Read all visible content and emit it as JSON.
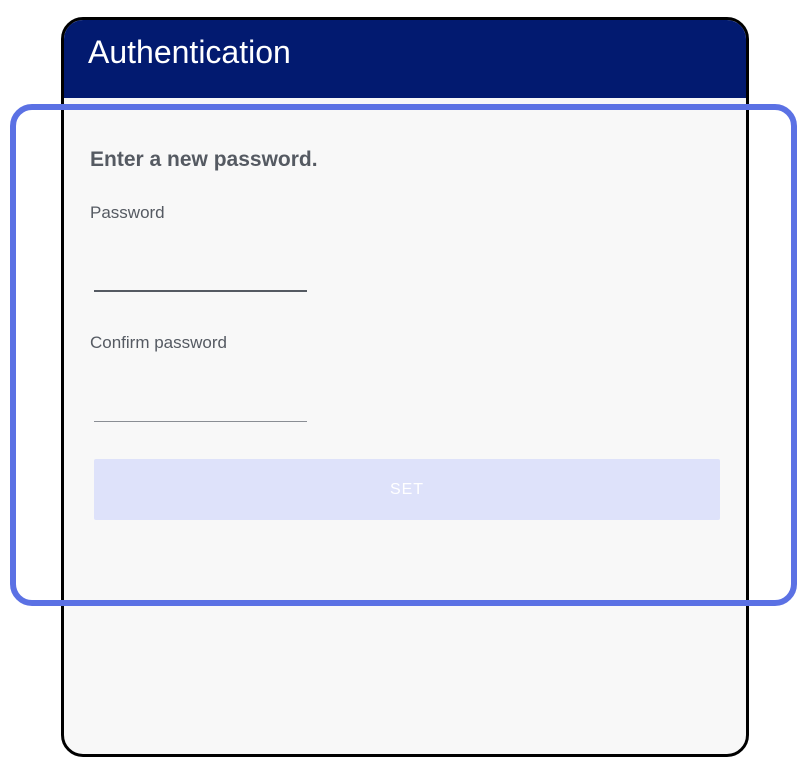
{
  "app_bar": {
    "title": "Authentication"
  },
  "form": {
    "heading": "Enter a new password.",
    "password_label": "Password",
    "password_value": "",
    "confirm_label": "Confirm password",
    "confirm_value": "",
    "set_button_label": "SET"
  },
  "colors": {
    "app_bar_bg": "#021a70",
    "highlight_border": "#5b71e4",
    "button_disabled_bg": "#dee2fa",
    "screen_bg": "#f8f8f8"
  }
}
